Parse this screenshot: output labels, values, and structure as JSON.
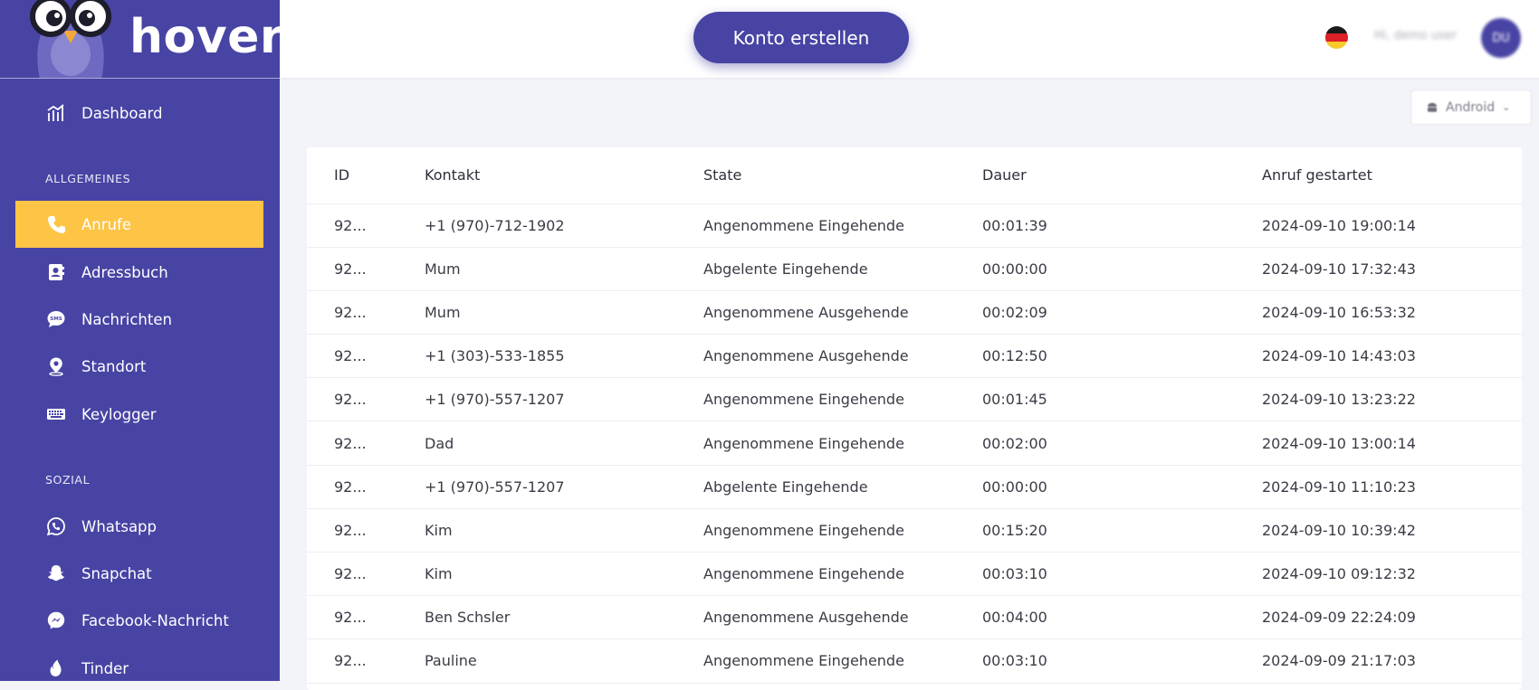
{
  "brand": {
    "name": "hoverv"
  },
  "header": {
    "cta_label": "Konto erstellen",
    "flag_icon": "germany-flag-icon",
    "user_name": "Hi, demo user",
    "avatar_initials": "DU"
  },
  "device_select": {
    "value": "Android",
    "icon": "android-icon"
  },
  "sidebar": {
    "dashboard": {
      "label": "Dashboard",
      "icon": "bar-chart-icon"
    },
    "sections": [
      {
        "label": "ALLGEMEINES",
        "items": [
          {
            "label": "Anrufe",
            "icon": "phone-icon",
            "active": true
          },
          {
            "label": "Adressbuch",
            "icon": "contact-book-icon"
          },
          {
            "label": "Nachrichten",
            "icon": "sms-icon"
          },
          {
            "label": "Standort",
            "icon": "location-pin-icon"
          },
          {
            "label": "Keylogger",
            "icon": "keyboard-icon"
          }
        ]
      },
      {
        "label": "SOZIAL",
        "items": [
          {
            "label": "Whatsapp",
            "icon": "whatsapp-icon"
          },
          {
            "label": "Snapchat",
            "icon": "snapchat-icon"
          },
          {
            "label": "Facebook-Nachricht",
            "icon": "messenger-icon"
          },
          {
            "label": "Tinder",
            "icon": "tinder-flame-icon"
          }
        ]
      }
    ]
  },
  "colors": {
    "sidebar_bg": "#4844a4",
    "active_item": "#fdc445",
    "page_bg": "#f3f4f9"
  },
  "calls_table": {
    "columns": [
      "ID",
      "Kontakt",
      "State",
      "Dauer",
      "Anruf gestartet"
    ],
    "rows": [
      [
        "92...",
        "+1 (970)-712-1902",
        "Angenommene Eingehende",
        "00:01:39",
        "2024-09-10 19:00:14"
      ],
      [
        "92...",
        "Mum",
        "Abgelente Eingehende",
        "00:00:00",
        "2024-09-10 17:32:43"
      ],
      [
        "92...",
        "Mum",
        "Angenommene Ausgehende",
        "00:02:09",
        "2024-09-10 16:53:32"
      ],
      [
        "92...",
        "+1 (303)-533-1855",
        "Angenommene Ausgehende",
        "00:12:50",
        "2024-09-10 14:43:03"
      ],
      [
        "92...",
        "+1 (970)-557-1207",
        "Angenommene Eingehende",
        "00:01:45",
        "2024-09-10 13:23:22"
      ],
      [
        "92...",
        "Dad",
        "Angenommene Eingehende",
        "00:02:00",
        "2024-09-10 13:00:14"
      ],
      [
        "92...",
        "+1 (970)-557-1207",
        "Abgelente Eingehende",
        "00:00:00",
        "2024-09-10 11:10:23"
      ],
      [
        "92...",
        "Kim",
        "Angenommene Eingehende",
        "00:15:20",
        "2024-09-10 10:39:42"
      ],
      [
        "92...",
        "Kim",
        "Angenommene Eingehende",
        "00:03:10",
        "2024-09-10 09:12:32"
      ],
      [
        "92...",
        "Ben Schsler",
        "Angenommene Ausgehende",
        "00:04:00",
        "2024-09-09 22:24:09"
      ],
      [
        "92...",
        "Pauline",
        "Angenommene Eingehende",
        "00:03:10",
        "2024-09-09 21:17:03"
      ]
    ]
  }
}
